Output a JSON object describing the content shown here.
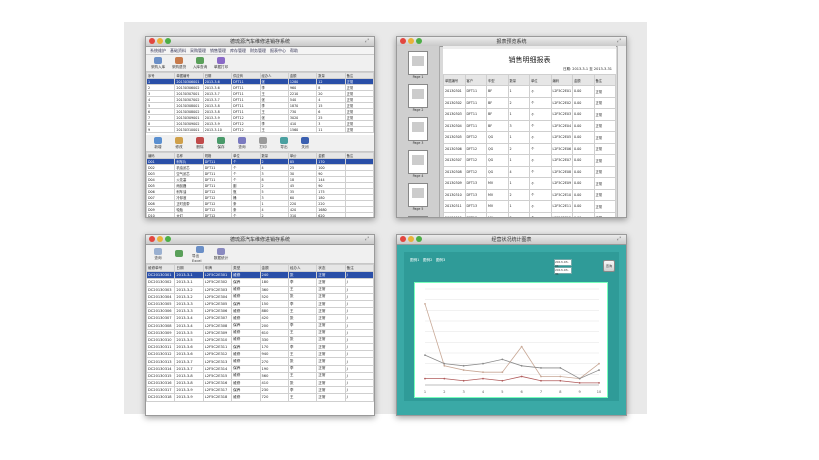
{
  "w1": {
    "title": "德琉源汽车维修进销存系统",
    "menu": [
      "系统维护",
      "基础资料",
      "采购管理",
      "销售管理",
      "库存管理",
      "财务管理",
      "报表中心",
      "帮助"
    ],
    "toolbar1": [
      "采购入库",
      "采购退货",
      "入库查询",
      "单据打印"
    ],
    "toolbar2": [
      "新增",
      "修改",
      "删除",
      "保存",
      "查询",
      "打印",
      "导出",
      "关闭"
    ],
    "headers_top": [
      "序号",
      "单据编号",
      "日期",
      "供应商",
      "经办人",
      "金额",
      "数量",
      "备注"
    ],
    "rows_top": [
      [
        "1",
        "20130306001",
        "2013-3-6",
        "DFT11",
        "张",
        "1280",
        "12",
        "正常"
      ],
      [
        "2",
        "20130306002",
        "2013-3-6",
        "DFT11",
        "李",
        "960",
        "8",
        "正常"
      ],
      [
        "3",
        "20130307001",
        "2013-3-7",
        "DFT11",
        "王",
        "2210",
        "20",
        "正常"
      ],
      [
        "4",
        "20130307002",
        "2013-3-7",
        "DFT11",
        "张",
        "540",
        "4",
        "正常"
      ],
      [
        "5",
        "20130308001",
        "2013-3-8",
        "DFT11",
        "李",
        "1870",
        "15",
        "正常"
      ],
      [
        "6",
        "20130308002",
        "2013-3-8",
        "DFT11",
        "王",
        "730",
        "6",
        "正常"
      ],
      [
        "7",
        "20130309001",
        "2013-3-9",
        "DFT12",
        "张",
        "3020",
        "25",
        "正常"
      ],
      [
        "8",
        "20130309002",
        "2013-3-9",
        "DFT12",
        "李",
        "410",
        "3",
        "正常"
      ],
      [
        "9",
        "20130310001",
        "2013-3-10",
        "DFT12",
        "王",
        "1560",
        "11",
        "正常"
      ]
    ],
    "headers_bottom": [
      "编码",
      "名称",
      "规格",
      "单位",
      "数量",
      "单价",
      "金额",
      "备注"
    ],
    "rows_bottom": [
      [
        "D01",
        "刹车片",
        "DFT11",
        "个",
        "2",
        "85",
        "170",
        ""
      ],
      [
        "D02",
        "机油滤芯",
        "DFT11",
        "个",
        "4",
        "25",
        "100",
        ""
      ],
      [
        "D03",
        "空气滤芯",
        "DFT11",
        "个",
        "3",
        "30",
        "90",
        ""
      ],
      [
        "D04",
        "火花塞",
        "DFT11",
        "个",
        "8",
        "18",
        "144",
        ""
      ],
      [
        "D05",
        "雨刮器",
        "DFT11",
        "副",
        "2",
        "45",
        "90",
        ""
      ],
      [
        "D06",
        "刹车油",
        "DFT12",
        "瓶",
        "5",
        "35",
        "175",
        ""
      ],
      [
        "D07",
        "冷却液",
        "DFT12",
        "桶",
        "3",
        "60",
        "180",
        ""
      ],
      [
        "D08",
        "正时皮带",
        "DFT12",
        "条",
        "1",
        "220",
        "220",
        ""
      ],
      [
        "D09",
        "轮胎",
        "DFT12",
        "条",
        "4",
        "420",
        "1680",
        ""
      ],
      [
        "D10",
        "大灯",
        "DFT12",
        "个",
        "2",
        "310",
        "620",
        ""
      ],
      [
        "D11",
        "后视镜",
        "DFT12",
        "个",
        "1",
        "150",
        "150",
        ""
      ],
      [
        "D12",
        "蓄电池",
        "DFT12",
        "个",
        "1",
        "480",
        "480",
        ""
      ],
      [
        "D13",
        "保险杠",
        "DFT12",
        "个",
        "1",
        "650",
        "650",
        ""
      ]
    ]
  },
  "w2": {
    "title": "报表预览系统",
    "thumb_labels": [
      "Page 1",
      "Page 2",
      "Page 3",
      "Page 4",
      "Page 5",
      "Page 6"
    ],
    "report_title": "销售明细报表",
    "report_meta": "日期: 2013-3-1 至 2013-3-31",
    "headers": [
      "单据编号",
      "客户",
      "车型",
      "数量",
      "单位",
      "编码",
      "金额",
      "备注"
    ],
    "rows": [
      [
        "20130301",
        "DFT11",
        "BF",
        "1",
        "个",
        "L2F5C2E01",
        "0.00",
        "正常"
      ],
      [
        "20130302",
        "DFT11",
        "BF",
        "2",
        "个",
        "L2F5C2E02",
        "0.00",
        "正常"
      ],
      [
        "20130303",
        "DFT11",
        "BF",
        "1",
        "个",
        "L2F5C2E03",
        "0.00",
        "正常"
      ],
      [
        "20130304",
        "DFT11",
        "BF",
        "3",
        "个",
        "L2F5C2E04",
        "0.00",
        "正常"
      ],
      [
        "20130305",
        "DFT12",
        "QG",
        "1",
        "个",
        "L2F5C2E05",
        "0.00",
        "正常"
      ],
      [
        "20130306",
        "DFT12",
        "QG",
        "2",
        "个",
        "L2F5C2E06",
        "0.00",
        "正常"
      ],
      [
        "20130307",
        "DFT12",
        "QG",
        "1",
        "个",
        "L2F5C2E07",
        "0.00",
        "正常"
      ],
      [
        "20130308",
        "DFT12",
        "QG",
        "4",
        "个",
        "L2F5C2E08",
        "0.00",
        "正常"
      ],
      [
        "20130309",
        "DFT13",
        "MV",
        "1",
        "个",
        "L2F5C2E09",
        "0.00",
        "正常"
      ],
      [
        "20130310",
        "DFT13",
        "MV",
        "2",
        "个",
        "L2F5C2E10",
        "0.00",
        "正常"
      ],
      [
        "20130311",
        "DFT13",
        "MV",
        "1",
        "个",
        "L2F5C2E11",
        "0.00",
        "正常"
      ],
      [
        "20130312",
        "DFT13",
        "MV",
        "3",
        "个",
        "L2F5C2E12",
        "0.00",
        "正常"
      ],
      [
        "20130313",
        "DFT13",
        "MV",
        "1",
        "个",
        "L2F5C2E13",
        "0.00",
        "正常"
      ]
    ]
  },
  "w3": {
    "title": "德琉源汽车维修进销存系统",
    "toolbar": [
      "查询",
      "",
      " 导出Excel",
      "数据统计"
    ],
    "headers": [
      "维修单号",
      "日期",
      "车牌",
      "类型",
      "金额",
      "经办人",
      "状态",
      "备注"
    ],
    "rows": [
      [
        "DC20130301",
        "2013-3-1",
        "L2F5C2E301",
        "维修",
        "240",
        "张",
        "正常",
        "J"
      ],
      [
        "DC20130302",
        "2013-3-1",
        "L2F5C2E302",
        "保养",
        "180",
        "李",
        "正常",
        "J"
      ],
      [
        "DC20130303",
        "2013-3-2",
        "L2F5C2E303",
        "维修",
        "360",
        "王",
        "正常",
        "J"
      ],
      [
        "DC20130304",
        "2013-3-2",
        "L2F5C2E304",
        "维修",
        "520",
        "张",
        "正常",
        "J"
      ],
      [
        "DC20130305",
        "2013-3-3",
        "L2F5C2E305",
        "保养",
        "150",
        "李",
        "正常",
        "J"
      ],
      [
        "DC20130306",
        "2013-3-3",
        "L2F5C2E306",
        "维修",
        "880",
        "王",
        "正常",
        "J"
      ],
      [
        "DC20130307",
        "2013-3-4",
        "L2F5C2E307",
        "维修",
        "420",
        "张",
        "正常",
        "J"
      ],
      [
        "DC20130308",
        "2013-3-4",
        "L2F5C2E308",
        "保养",
        "200",
        "李",
        "正常",
        "J"
      ],
      [
        "DC20130309",
        "2013-3-5",
        "L2F5C2E309",
        "维修",
        "610",
        "王",
        "正常",
        "J"
      ],
      [
        "DC20130310",
        "2013-3-5",
        "L2F5C2E310",
        "维修",
        "330",
        "张",
        "正常",
        "J"
      ],
      [
        "DC20130311",
        "2013-3-6",
        "L2F5C2E311",
        "保养",
        "170",
        "李",
        "正常",
        "J"
      ],
      [
        "DC20130312",
        "2013-3-6",
        "L2F5C2E312",
        "维修",
        "940",
        "王",
        "正常",
        "J"
      ],
      [
        "DC20130313",
        "2013-3-7",
        "L2F5C2E313",
        "维修",
        "270",
        "张",
        "正常",
        "J"
      ],
      [
        "DC20130314",
        "2013-3-7",
        "L2F5C2E314",
        "保养",
        "190",
        "李",
        "正常",
        "J"
      ],
      [
        "DC20130315",
        "2013-3-8",
        "L2F5C2E315",
        "维修",
        "560",
        "王",
        "正常",
        "J"
      ],
      [
        "DC20130316",
        "2013-3-8",
        "L2F5C2E316",
        "维修",
        "410",
        "张",
        "正常",
        "J"
      ],
      [
        "DC20130317",
        "2013-3-9",
        "L2F5C2E317",
        "保养",
        "230",
        "李",
        "正常",
        "J"
      ],
      [
        "DC20130318",
        "2013-3-9",
        "L2F5C2E318",
        "维修",
        "720",
        "王",
        "正常",
        "J"
      ]
    ]
  },
  "w4": {
    "title": "经营状况统计图表",
    "legend": [
      "图例1",
      "图例2",
      "图例3"
    ],
    "date_from": "2013-03-01",
    "date_to": "2013-03-31",
    "btn": "查询"
  },
  "chart_data": {
    "type": "line",
    "categories": [
      "1",
      "2",
      "3",
      "4",
      "5",
      "6",
      "7",
      "8",
      "9",
      "10"
    ],
    "series": [
      {
        "values": [
          38,
          9,
          7,
          6,
          6,
          18,
          4,
          4,
          3,
          10
        ]
      },
      {
        "values": [
          14,
          10,
          9,
          10,
          12,
          9,
          8,
          8,
          3,
          7
        ]
      },
      {
        "values": [
          3,
          3,
          2,
          3,
          2,
          4,
          2,
          2,
          1,
          1
        ]
      }
    ],
    "ylim": [
      0,
      45
    ],
    "grid": true
  },
  "colors": {
    "series1": "#c8a896",
    "series2": "#8a8a8a",
    "series3": "#b05a5a",
    "teal": "#3aa9a6"
  }
}
